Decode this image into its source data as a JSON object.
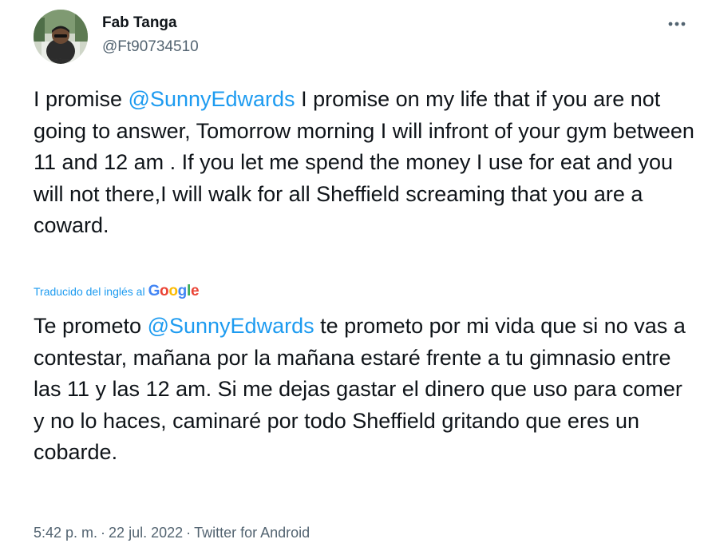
{
  "author": {
    "display_name": "Fab Tanga",
    "handle": "@Ft90734510",
    "avatar_caption": "Fab Tanga"
  },
  "original_text": {
    "before_mention": "I promise ",
    "mention": "@SunnyEdwards",
    "after_mention": " I promise on my life that if you are not going to answer, Tomorrow morning I will infront of your gym between 11 and 12 am . If you let me spend the money I use for eat and you will not there,I will walk for all Sheffield screaming that you are a coward."
  },
  "translation": {
    "label": "Traducido del inglés al",
    "provider": "Google",
    "before_mention": "Te prometo ",
    "mention": "@SunnyEdwards",
    "after_mention": " te prometo por mi vida que si no vas a contestar, mañana por la mañana estaré frente a tu gimnasio entre las 11 y las 12 am. Si me dejas gastar el dinero que uso para comer y no lo haces, caminaré por todo Sheffield gritando que eres un cobarde."
  },
  "footer": {
    "time": "5:42 p. m.",
    "separator": "·",
    "date": "22 jul. 2022",
    "source": "Twitter for Android"
  },
  "icons": {
    "more": "more-horizontal-icon"
  },
  "colors": {
    "accent": "#1d9bf0",
    "text": "#0f1419",
    "secondary": "#536471",
    "google_blue": "#4285F4",
    "google_red": "#EA4335",
    "google_yellow": "#FBBC05",
    "google_green": "#34A853"
  }
}
